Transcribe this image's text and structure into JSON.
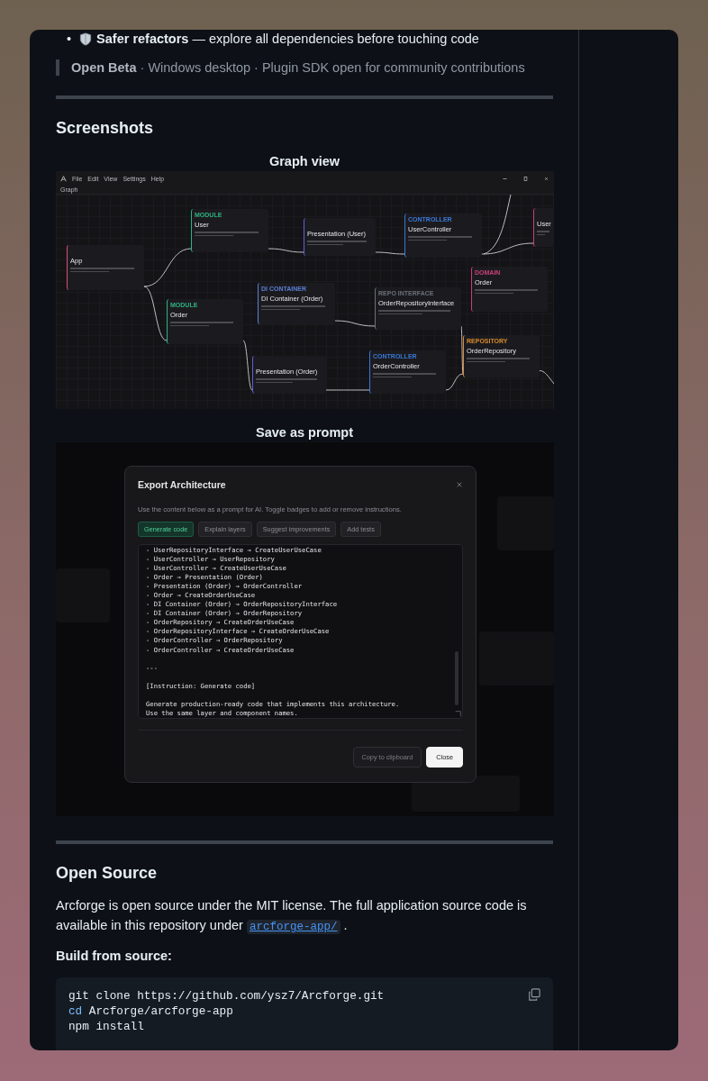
{
  "feature_list": [
    {
      "bullet": "•",
      "text": "**Safer refactors** — explore all dependencies before touching code"
    }
  ],
  "note": "**Open Beta** · Windows desktop · Plugin SDK open for community contributions",
  "screenshots": {
    "heading": "Screenshots",
    "figures": [
      {
        "kind": "graph",
        "caption": "Graph view",
        "app": {
          "menu": [
            "File",
            "Edit",
            "View",
            "Settings",
            "Help"
          ],
          "tab": "Graph",
          "nodes": [
            {
              "title": "App",
              "color": "#d94f7a"
            },
            {
              "title": "User",
              "tag": "MODULE",
              "color": "#2fb380"
            },
            {
              "title": "Order",
              "tag": "MODULE",
              "color": "#2fb380"
            },
            {
              "title": "DI Container (Order)",
              "tag": "DI CONTAINER",
              "color": "#5b7fd6"
            },
            {
              "title": "Presentation (Order)",
              "color": "#6060d8"
            },
            {
              "title": "Presentation (User)",
              "color": "#6060d8"
            },
            {
              "title": "UserController",
              "tag": "CONTROLLER",
              "color": "#3a78d8"
            },
            {
              "title": "User",
              "color": "#c8407a"
            },
            {
              "title": "Order",
              "tag": "DOMAIN",
              "color": "#c8407a"
            },
            {
              "title": "OrderRepositoryInterface",
              "tag": "REPO INTERFACE",
              "color": "#6b6f78"
            },
            {
              "title": "OrderRepository",
              "tag": "REPOSITORY",
              "color": "#d98a2a"
            },
            {
              "title": "OrderController",
              "tag": "CONTROLLER",
              "color": "#3a78d8"
            }
          ]
        }
      },
      {
        "kind": "dialog",
        "caption": "Save as prompt",
        "dialog": {
          "title": "Export Architecture",
          "description": "Use the content below as a prompt for AI. Toggle badges to add or remove instructions.",
          "badges": [
            {
              "label": "Generate code",
              "selected": true
            },
            {
              "label": "Explain layers",
              "selected": false
            },
            {
              "label": "Suggest improvements",
              "selected": false
            },
            {
              "label": "Add tests",
              "selected": false
            }
          ],
          "prompt_blocks": [
            [
              "- UserRepositoryInterface → CreateUserUseCase",
              "- UserController → UserRepository",
              "- UserController → CreateUserUseCase",
              "- Order → Presentation (Order)",
              "- Presentation (Order) → OrderController",
              "- Order → CreateOrderUseCase",
              "- DI Container (Order) → OrderRepositoryInterface",
              "- DI Container (Order) → OrderRepository",
              "- OrderRepository → CreateOrderUseCase",
              "- OrderRepositoryInterface → CreateOrderUseCase",
              "- OrderController → OrderRepository",
              "- OrderController → CreateOrderUseCase"
            ],
            [
              "---"
            ],
            [
              "[Instruction: Generate code]"
            ],
            [
              "Generate production-ready code that implements this architecture.",
              "Use the same layer and component names."
            ]
          ],
          "buttons": [
            {
              "label": "Copy to clipboard",
              "kind": "secondary"
            },
            {
              "label": "Close",
              "kind": "primary"
            }
          ]
        }
      }
    ]
  },
  "open_source": {
    "heading": "Open Source",
    "paragraph": {
      "text": "Arcforge is open source under the MIT license. The full application source code is available in this repository under",
      "link": "arcforge-app/",
      "after": "."
    },
    "subheading": "Build from source:",
    "code_lines": [
      {
        "text": "git clone https://github.com/ysz7/Arcforge.git"
      },
      {
        "builtin": "cd",
        "text": "Arcforge/arcforge-app"
      },
      {
        "text": "npm install"
      }
    ]
  }
}
